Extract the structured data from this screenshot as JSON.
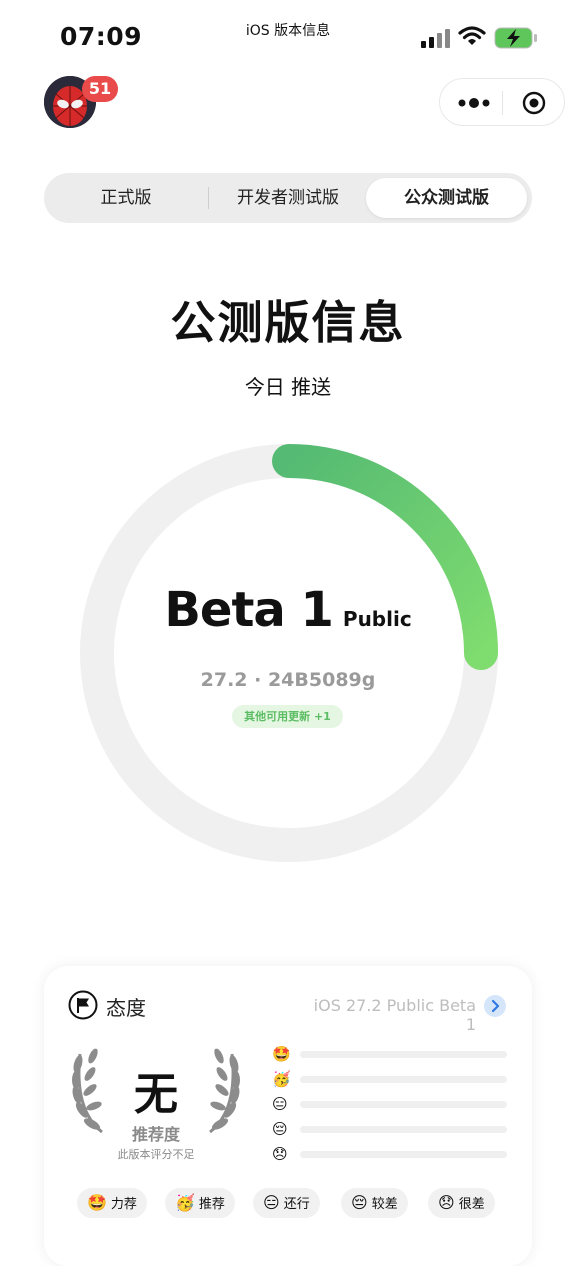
{
  "status_bar": {
    "time": "07:09",
    "center_title": "iOS 版本信息"
  },
  "header": {
    "avatar_icon": "spiderman-avatar",
    "notification_count": "51",
    "capsule": {
      "more_icon": "more-dots-icon",
      "close_icon": "target-icon"
    }
  },
  "tabs": {
    "items": [
      {
        "label": "正式版"
      },
      {
        "label": "开发者测试版"
      },
      {
        "label": "公众测试版"
      }
    ],
    "active_index": 2
  },
  "main": {
    "title": "公测版信息",
    "subtitle": "今日 推送",
    "version_name": "Beta 1",
    "version_tag": "Public",
    "build": "27.2 · 24B5089g",
    "other_updates": "其他可用更新 +1",
    "ring_progress_fraction": 0.25,
    "ring_colors": {
      "track": "#f0f0f0",
      "start": "#55ba73",
      "end": "#7fdc6f"
    }
  },
  "attitude_card": {
    "title": "态度",
    "version_ref": "iOS 27.2 Public Beta 1",
    "rating_value": "无",
    "rating_label": "推荐度",
    "rating_note": "此版本评分不足",
    "distribution": [
      {
        "emoji": "🤩",
        "fraction": 0
      },
      {
        "emoji": "🥳",
        "fraction": 0
      },
      {
        "emoji": "😑",
        "fraction": 0
      },
      {
        "emoji": "😔",
        "fraction": 0
      },
      {
        "emoji": "😞",
        "fraction": 0
      }
    ],
    "votes": [
      {
        "emoji": "🤩",
        "label": "力荐"
      },
      {
        "emoji": "🥳",
        "label": "推荐"
      },
      {
        "emoji": "😑",
        "label": "还行"
      },
      {
        "emoji": "😔",
        "label": "较差"
      },
      {
        "emoji": "😞",
        "label": "很差"
      }
    ]
  }
}
